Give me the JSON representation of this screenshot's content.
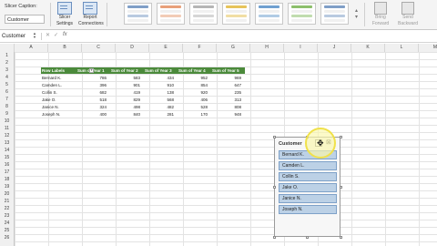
{
  "ribbon": {
    "slicer_caption_label": "Slicer Caption:",
    "slicer_caption_value": "Customer",
    "buttons": [
      {
        "label_line1": "Slicer",
        "label_line2": "Settings"
      },
      {
        "label_line1": "Report",
        "label_line2": "Connections"
      }
    ],
    "right_buttons": [
      {
        "label_line1": "Bring",
        "label_line2": "Forward"
      },
      {
        "label_line1": "Send",
        "label_line2": "Backward"
      }
    ],
    "style_colors": [
      "#7f9fc7",
      "#e8a07a",
      "#b5b5b5",
      "#e6c35a",
      "#6fa0d0",
      "#8cbf6b",
      "#7f9fc7"
    ]
  },
  "formula_bar": {
    "name_box": "Customer",
    "cancel_symbol": "✕",
    "enter_symbol": "✓",
    "fx_label": "fx"
  },
  "grid": {
    "columns": [
      "A",
      "B",
      "C",
      "D",
      "E",
      "F",
      "G",
      "H",
      "I",
      "J",
      "K",
      "L",
      "M"
    ],
    "rows": [
      "1",
      "2",
      "3",
      "4",
      "5",
      "6",
      "7",
      "8",
      "9",
      "10",
      "11",
      "12",
      "13",
      "14",
      "15",
      "16",
      "17",
      "18",
      "19",
      "20",
      "21",
      "22",
      "23",
      "24",
      "25",
      "26"
    ]
  },
  "pivot": {
    "headers": [
      "Row Labels",
      "Sum of Year 1",
      "Sum of Year 2",
      "Sum of Year 3",
      "Sum of Year 4",
      "Sum of Year 5"
    ],
    "rows": [
      {
        "label": "Bernard K.",
        "values": [
          "786",
          "583",
          "434",
          "952",
          "969"
        ]
      },
      {
        "label": "Camden L.",
        "values": [
          "396",
          "901",
          "910",
          "854",
          "647"
        ]
      },
      {
        "label": "Collin S.",
        "values": [
          "682",
          "419",
          "138",
          "920",
          "235"
        ]
      },
      {
        "label": "Jake O.",
        "values": [
          "518",
          "829",
          "568",
          "406",
          "313"
        ]
      },
      {
        "label": "Janice N.",
        "values": [
          "324",
          "498",
          "482",
          "528",
          "808"
        ]
      },
      {
        "label": "Joseph N.",
        "values": [
          "400",
          "840",
          "281",
          "170",
          "948"
        ]
      }
    ],
    "header_color": "#4b8a3b"
  },
  "slicer": {
    "title": "Customer",
    "items": [
      "Bernard K.",
      "Camden L.",
      "Collin S.",
      "Jake O.",
      "Janice N.",
      "Joseph N."
    ],
    "item_color": "#bcd1e6"
  }
}
